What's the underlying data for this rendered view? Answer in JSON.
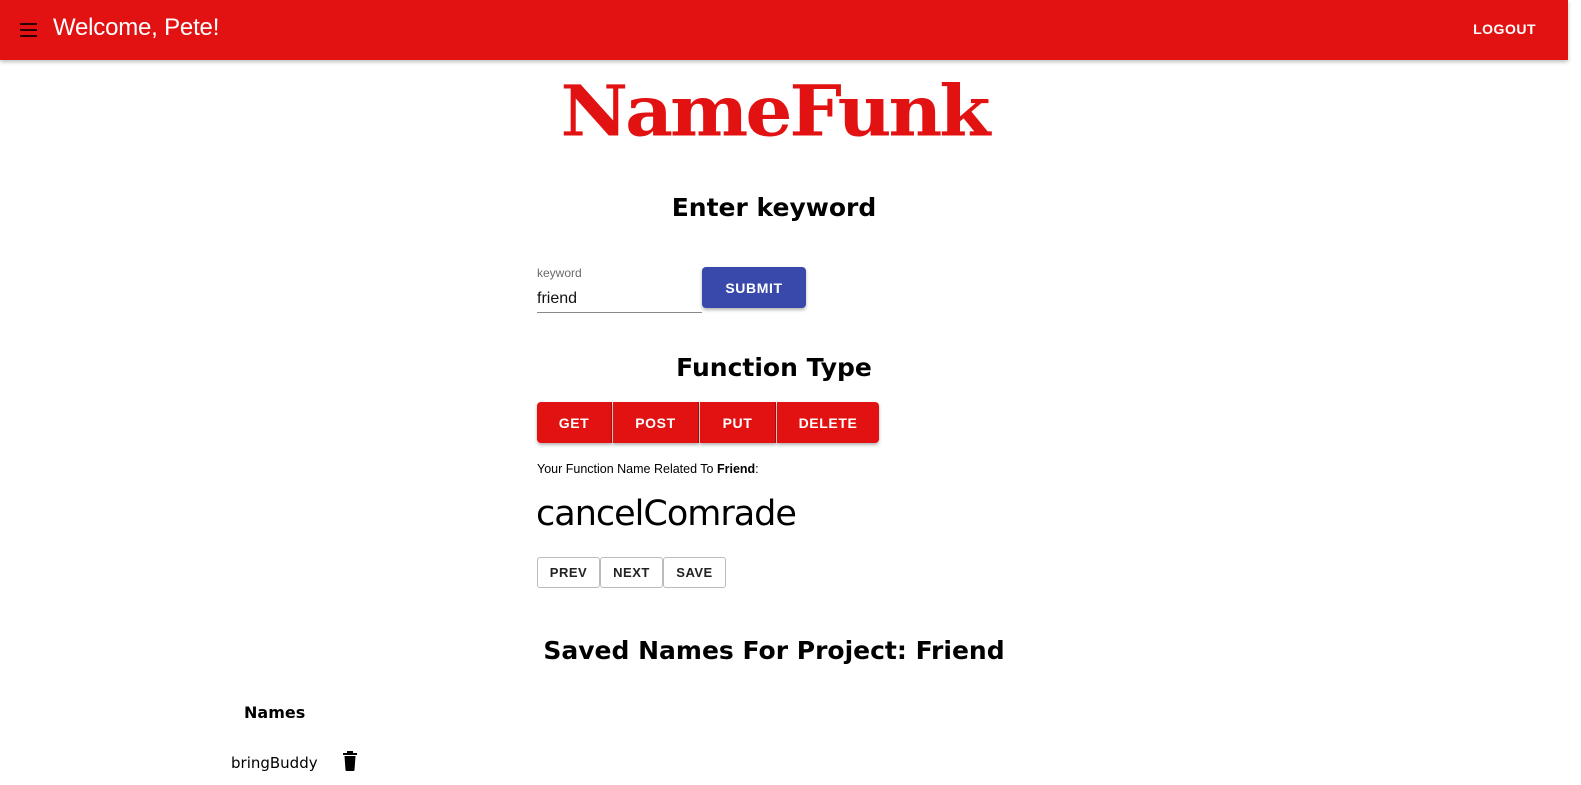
{
  "header": {
    "title": "Welcome, Pete!",
    "logout_label": "LOGOUT",
    "menu_icon": "hamburger-menu-icon",
    "color": "#e31212"
  },
  "logo": {
    "text": "NameFunk",
    "color": "#e31212"
  },
  "keyword_section": {
    "heading": "Enter keyword",
    "input_label": "keyword",
    "input_value": "friend",
    "submit_label": "SUBMIT",
    "submit_color": "#3949ab"
  },
  "function_section": {
    "heading": "Function Type",
    "buttons": [
      "GET",
      "POST",
      "PUT",
      "DELETE"
    ],
    "related_prefix": "Your Function Name Related To ",
    "related_keyword": "Friend",
    "related_suffix": ":",
    "result_name": "cancelComrade",
    "nav": {
      "prev_label": "PREV",
      "next_label": "NEXT",
      "save_label": "SAVE"
    }
  },
  "saved_section": {
    "heading": "Saved Names For Project: Friend",
    "column_header": "Names",
    "rows": [
      {
        "name": "bringBuddy",
        "delete_icon": "trash-icon"
      }
    ]
  }
}
